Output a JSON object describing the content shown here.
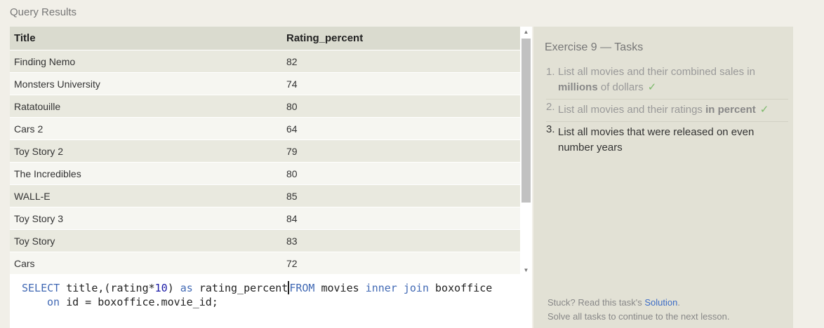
{
  "results_title": "Query Results",
  "table": {
    "headers": [
      "Title",
      "Rating_percent"
    ],
    "rows": [
      [
        "Finding Nemo",
        "82"
      ],
      [
        "Monsters University",
        "74"
      ],
      [
        "Ratatouille",
        "80"
      ],
      [
        "Cars 2",
        "64"
      ],
      [
        "Toy Story 2",
        "79"
      ],
      [
        "The Incredibles",
        "80"
      ],
      [
        "WALL-E",
        "85"
      ],
      [
        "Toy Story 3",
        "84"
      ],
      [
        "Toy Story",
        "83"
      ],
      [
        "Cars",
        "72"
      ]
    ]
  },
  "editor": {
    "select": "SELECT",
    "title_col": "title,(rating*",
    "ten": "10",
    "close_paren": ")",
    "as": "as",
    "alias": "rating_percent",
    "from": "FROM",
    "movies": "movies",
    "inner": "inner",
    "join": "join",
    "boxoffice": "boxoffice",
    "on": "on",
    "condition": "id = boxoffice.movie_id;"
  },
  "tasks": {
    "title": "Exercise 9 — Tasks",
    "t1": {
      "num": "1.",
      "text_a": "List all movies and their combined sales in",
      "strong": "millions",
      "text_b": " of dollars",
      "check": "✓"
    },
    "t2": {
      "num": "2.",
      "text_a": "List all movies and their ratings ",
      "strong": "in percent",
      "check": "✓"
    },
    "t3": {
      "num": "3.",
      "text": "List all movies that were released on even number years"
    }
  },
  "footer": {
    "stuck": "Stuck? Read this task's ",
    "solution": "Solution",
    "period": ".",
    "next": "Solve all tasks to continue to the next lesson."
  },
  "scroll": {
    "up": "▲",
    "down": "▼"
  },
  "colors": {
    "background": "#f1efe8",
    "header_row": "#dadbcf",
    "tasks_panel": "#e2e1d5",
    "keyword": "#4169b4",
    "check": "#7cb96a",
    "link": "#3c6cc6"
  }
}
